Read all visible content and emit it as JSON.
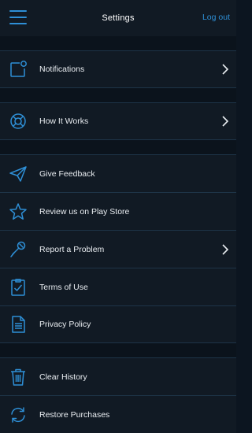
{
  "header": {
    "title": "Settings",
    "logout_label": "Log out",
    "menu_icon": "hamburger-menu-icon"
  },
  "colors": {
    "accent": "#2e8fd6",
    "row_background": "#111a24",
    "page_background": "#0c1520",
    "divider": "#1e3448"
  },
  "items": [
    {
      "label": "Notifications",
      "icon": "notification-icon",
      "has_chevron": true
    },
    {
      "label": "How It Works",
      "icon": "lifebuoy-icon",
      "has_chevron": true
    },
    {
      "label": "Give Feedback",
      "icon": "paper-plane-icon",
      "has_chevron": false
    },
    {
      "label": "Review us on Play Store",
      "icon": "star-icon",
      "has_chevron": false
    },
    {
      "label": "Report a Problem",
      "icon": "microphone-icon",
      "has_chevron": true
    },
    {
      "label": "Terms of Use",
      "icon": "clipboard-check-icon",
      "has_chevron": false
    },
    {
      "label": "Privacy Policy",
      "icon": "document-icon",
      "has_chevron": false
    },
    {
      "label": "Clear History",
      "icon": "trash-icon",
      "has_chevron": false
    },
    {
      "label": "Restore Purchases",
      "icon": "refresh-icon",
      "has_chevron": false
    }
  ]
}
